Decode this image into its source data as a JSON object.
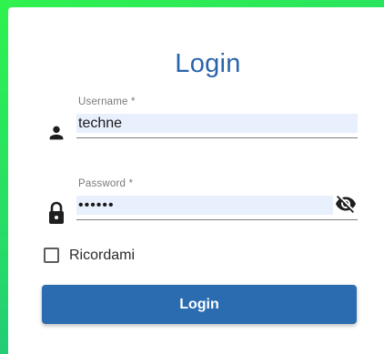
{
  "login_form": {
    "title": "Login",
    "username": {
      "label": "Username *",
      "value": "techne",
      "icon": "person-icon"
    },
    "password": {
      "label": "Password *",
      "value": "••••••",
      "icon": "lock-icon",
      "visibility_icon": "eye-off-icon"
    },
    "remember_me": {
      "label": "Ricordami",
      "checked": false
    },
    "submit_label": "Login"
  },
  "colors": {
    "accent": "#2b6cb0",
    "title": "#2b64ad",
    "input_fill": "#e8f0fe",
    "background_gradient": [
      "#2ff24f",
      "#1fb58c"
    ]
  }
}
